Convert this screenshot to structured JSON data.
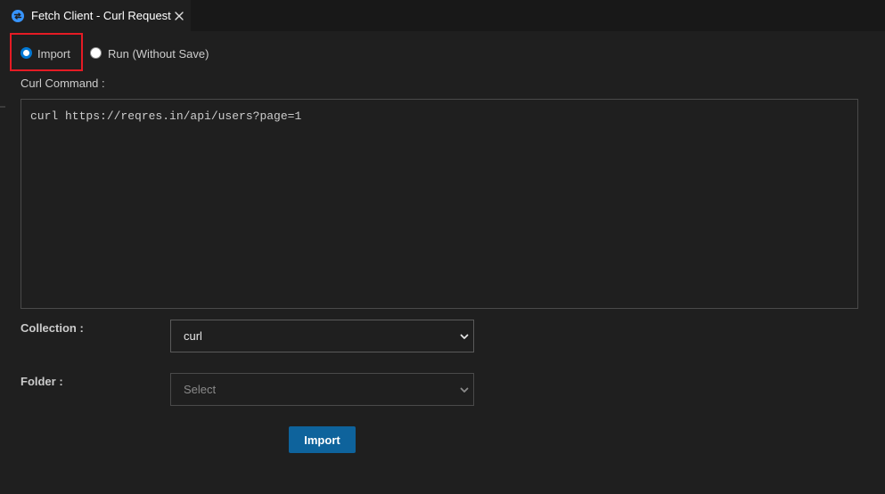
{
  "tab": {
    "title": "Fetch Client - Curl Request",
    "icon": "fetch-client-icon",
    "close_icon": "close-icon"
  },
  "mode": {
    "options": [
      {
        "label": "Import",
        "checked": true
      },
      {
        "label": "Run (Without Save)",
        "checked": false
      }
    ]
  },
  "curl": {
    "label": "Curl Command :",
    "value": "curl https://reqres.in/api/users?page=1"
  },
  "collection": {
    "label": "Collection :",
    "value": "curl"
  },
  "folder": {
    "label": "Folder :",
    "value": "Select"
  },
  "actions": {
    "import_label": "Import"
  },
  "colors": {
    "background": "#1f1f1f",
    "accent": "#0078d4",
    "button": "#0e639c",
    "highlight": "#e51b24"
  }
}
